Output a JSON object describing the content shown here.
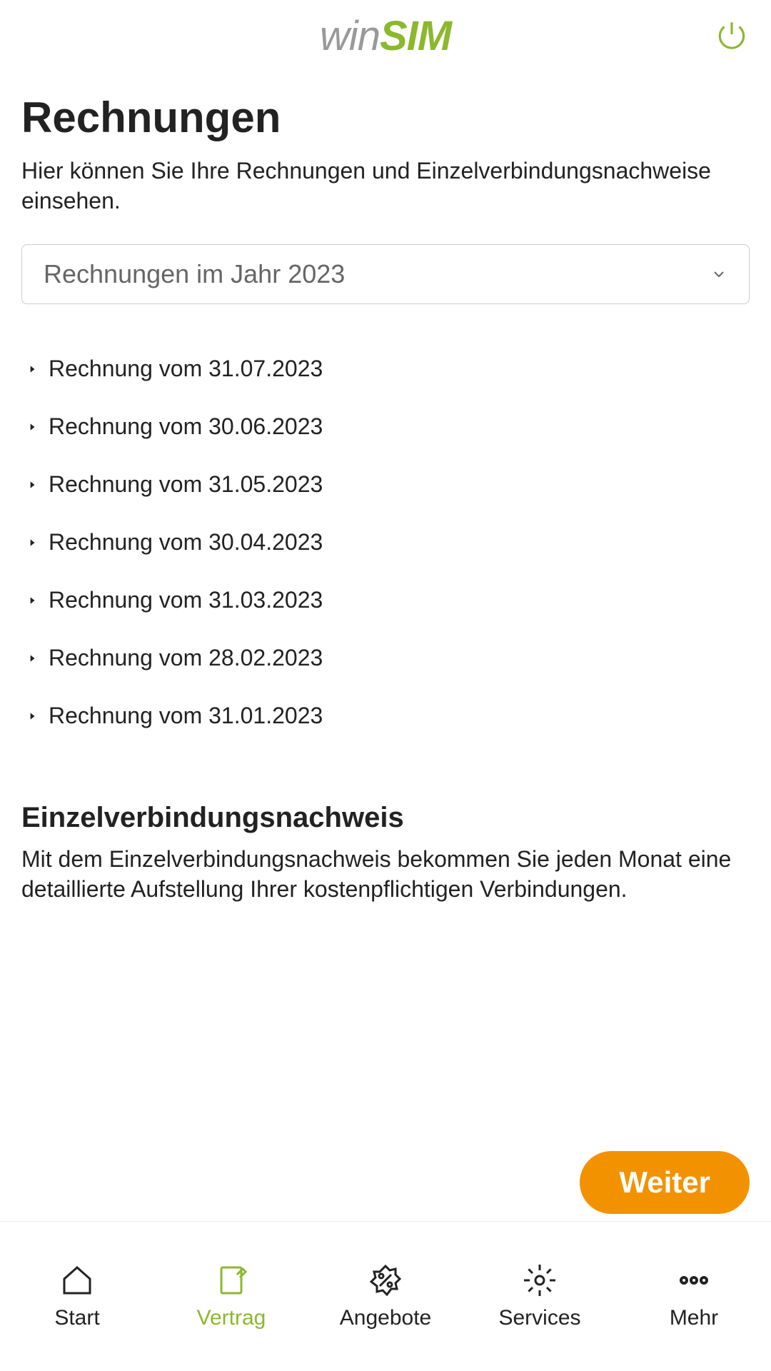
{
  "header": {
    "logo_part1": "win",
    "logo_part2": "SIM"
  },
  "main": {
    "page_title": "Rechnungen",
    "page_subtitle": "Hier können Sie Ihre Rechnungen und Einzelverbindungsnachweise einsehen.",
    "dropdown_label": "Rechnungen im Jahr 2023",
    "invoices": [
      {
        "label": "Rechnung vom 31.07.2023"
      },
      {
        "label": "Rechnung vom 30.06.2023"
      },
      {
        "label": "Rechnung vom 31.05.2023"
      },
      {
        "label": "Rechnung vom 30.04.2023"
      },
      {
        "label": "Rechnung vom 31.03.2023"
      },
      {
        "label": "Rechnung vom 28.02.2023"
      },
      {
        "label": "Rechnung vom 31.01.2023"
      }
    ],
    "evn_title": "Einzelverbindungsnachweis",
    "evn_text": "Mit dem Einzelverbindungsnachweis bekommen Sie jeden Monat eine detaillierte Aufstellung Ihrer kostenpflichtigen Verbindungen.",
    "cta_label": "Weiter"
  },
  "nav": {
    "items": [
      {
        "label": "Start"
      },
      {
        "label": "Vertrag"
      },
      {
        "label": "Angebote"
      },
      {
        "label": "Services"
      },
      {
        "label": "Mehr"
      }
    ]
  },
  "colors": {
    "accent_green": "#8cb82e",
    "accent_orange": "#f39200"
  }
}
